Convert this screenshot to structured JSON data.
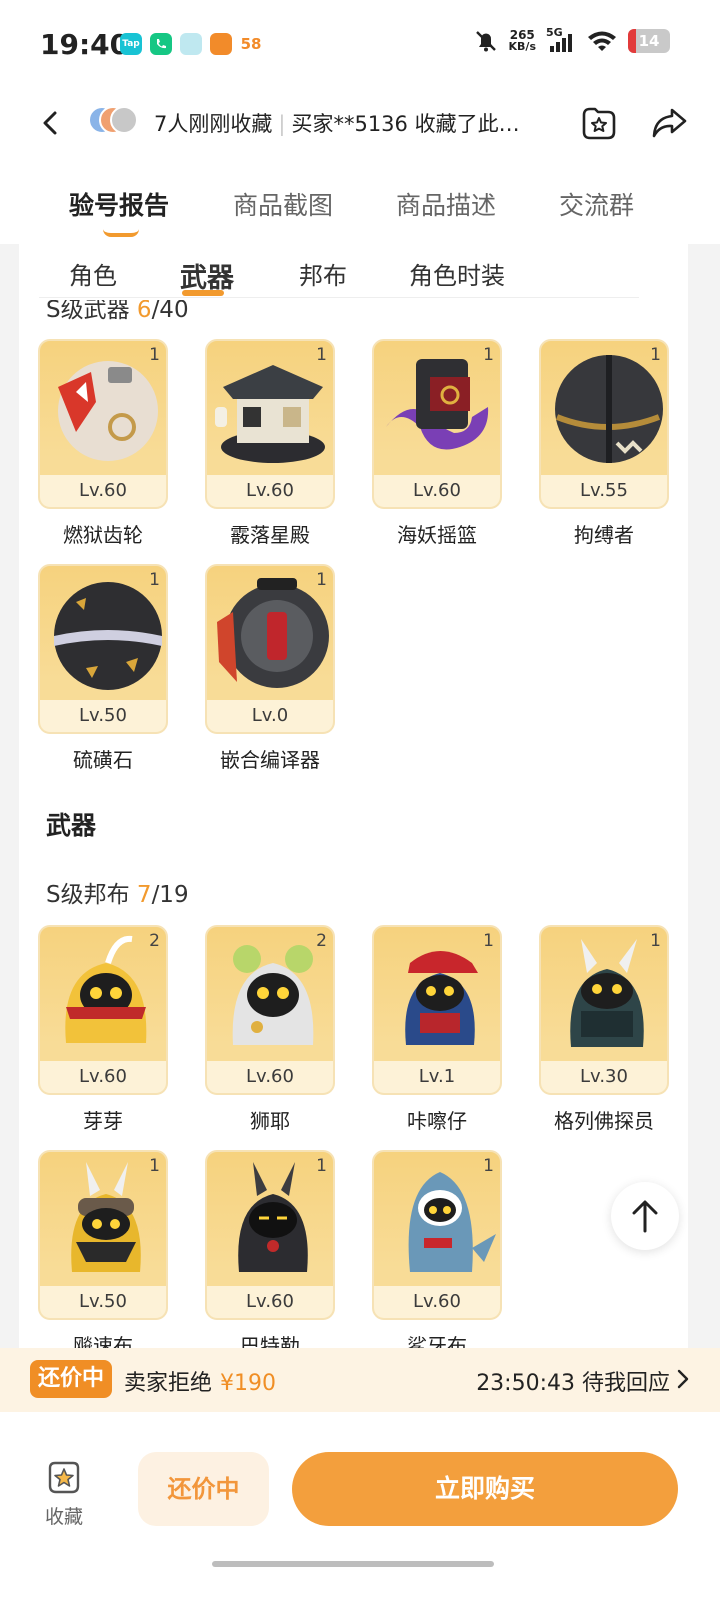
{
  "status": {
    "time": "19:40",
    "apps": [
      "Tap",
      "",
      "",
      "",
      "58"
    ],
    "speed_value": "265",
    "speed_unit": "KB/s",
    "network": "5G",
    "battery": "14"
  },
  "header": {
    "watch_text": "7人刚刚收藏",
    "buyer_text": "买家**5136 收藏了此…"
  },
  "tabs": [
    "验号报告",
    "商品截图",
    "商品描述",
    "交流群"
  ],
  "subtabs": [
    "角色",
    "武器",
    "邦布",
    "角色时装"
  ],
  "weapons_section": {
    "title": "S级武器 ",
    "owned": "6",
    "total": "/40",
    "items": [
      {
        "count": "1",
        "level": "Lv.60",
        "name": "燃狱齿轮"
      },
      {
        "count": "1",
        "level": "Lv.60",
        "name": "霰落星殿"
      },
      {
        "count": "1",
        "level": "Lv.60",
        "name": "海妖摇篮"
      },
      {
        "count": "1",
        "level": "Lv.55",
        "name": "拘缚者"
      },
      {
        "count": "1",
        "level": "Lv.50",
        "name": "硫磺石"
      },
      {
        "count": "1",
        "level": "Lv.0",
        "name": "嵌合编译器"
      }
    ]
  },
  "weapons_heading": "武器",
  "bangboo_section": {
    "title": "S级邦布 ",
    "owned": "7",
    "total": "/19",
    "items": [
      {
        "count": "2",
        "level": "Lv.60",
        "name": "芽芽"
      },
      {
        "count": "2",
        "level": "Lv.60",
        "name": "狮耶"
      },
      {
        "count": "1",
        "level": "Lv.1",
        "name": "咔嚓仔"
      },
      {
        "count": "1",
        "level": "Lv.30",
        "name": "格列佛探员"
      },
      {
        "count": "1",
        "level": "Lv.50",
        "name": "飚速布"
      },
      {
        "count": "1",
        "level": "Lv.60",
        "name": "巴特勒"
      },
      {
        "count": "1",
        "level": "Lv.60",
        "name": "鲨牙布"
      }
    ]
  },
  "bargain": {
    "badge": "还价中",
    "text": "卖家拒绝",
    "price": "¥190",
    "countdown": "23:50:43 待我回应"
  },
  "bottom": {
    "fav_label": "收藏",
    "counter_label": "还价中",
    "buy_label": "立即购买"
  },
  "colors": {
    "accent": "#f29a2e",
    "buy": "#f39f3d"
  }
}
